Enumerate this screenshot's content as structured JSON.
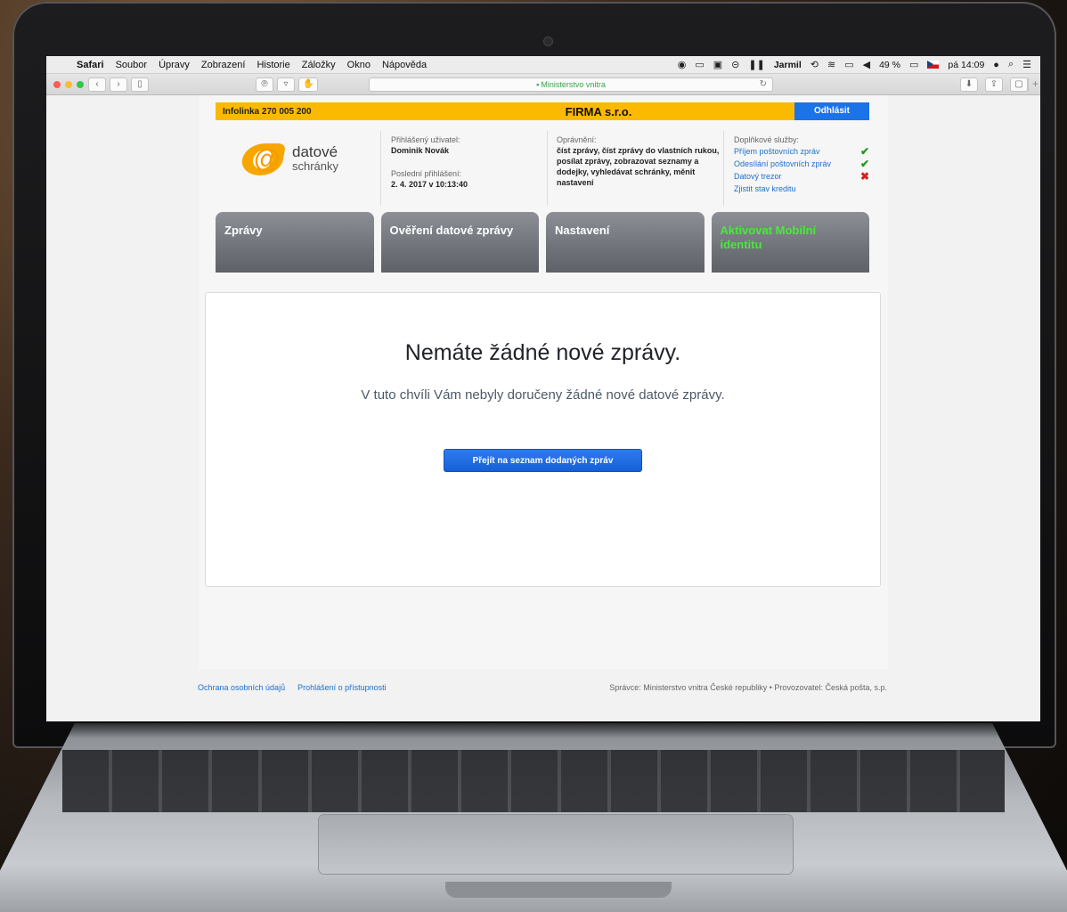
{
  "menubar": {
    "app_name": "Safari",
    "items": [
      "Soubor",
      "Úpravy",
      "Zobrazení",
      "Historie",
      "Záložky",
      "Okno",
      "Nápověda"
    ],
    "user": "Jarmil",
    "battery": "49 %",
    "clock": "pá 14:09"
  },
  "browser": {
    "address": "Ministerstvo vnitra"
  },
  "topbar": {
    "infoline": "Infolinka 270 005 200",
    "company": "FIRMA s.r.o.",
    "logout": "Odhlásit"
  },
  "logo": {
    "word1": "datové",
    "word2": "schránky"
  },
  "user_info": {
    "logged_label": "Přihlášený uživatel:",
    "logged_value": "Dominik Novák",
    "last_login_label": "Poslední přihlášení:",
    "last_login_value": "2. 4. 2017 v 10:13:40"
  },
  "permissions": {
    "label": "Oprávnění:",
    "value": "číst zprávy, číst zprávy do vlastních rukou, posílat zprávy, zobrazovat seznamy a dodejky, vyhledávat schránky, měnit nastavení"
  },
  "services": {
    "label": "Doplňkové služby:",
    "items": [
      {
        "label": "Příjem poštovních zpráv",
        "status": "ok"
      },
      {
        "label": "Odesílání poštovních zpráv",
        "status": "ok"
      },
      {
        "label": "Datový trezor",
        "status": "no"
      },
      {
        "label": "Zjistit stav kreditu",
        "status": ""
      }
    ]
  },
  "tabs": [
    {
      "label": "Zprávy"
    },
    {
      "label": "Ověření datové zprávy"
    },
    {
      "label": "Nastavení"
    },
    {
      "label": "Aktivovat Mobilní identitu"
    }
  ],
  "content": {
    "title": "Nemáte žádné nové zprávy.",
    "subtitle": "V tuto chvíli Vám nebyly doručeny žádné nové datové zprávy.",
    "cta": "Přejít na seznam dodaných zpráv"
  },
  "footer": {
    "link1": "Ochrana osobních údajů",
    "link2": "Prohlášení o přístupnosti",
    "operator": "Správce: Ministerstvo vnitra České republiky • Provozovatel: Česká pošta, s.p."
  },
  "colors": {
    "topbar": "#fbba00",
    "logout": "#1a73e8",
    "tab_accent_text": "#49e93a",
    "link": "#1a6fd0"
  }
}
